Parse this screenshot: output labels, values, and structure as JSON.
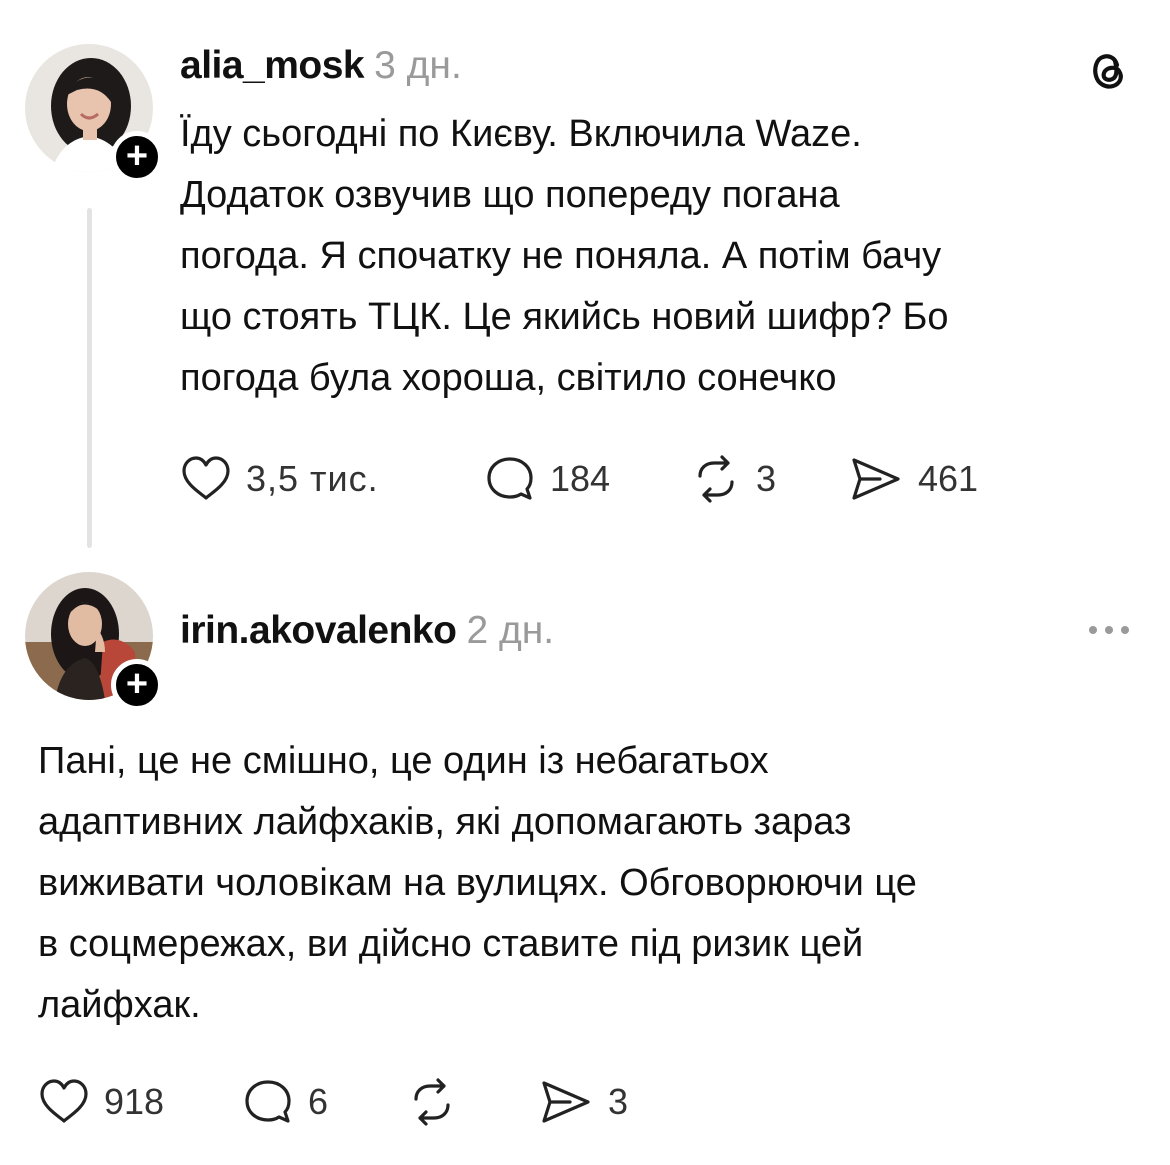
{
  "post": {
    "username": "alia_mosk",
    "time": "3 дн.",
    "lines": [
      "Їду сьогодні по Києву. Включила Waze.",
      "Додаток озвучив що попереду погана",
      "погода. Я спочатку не поняла. А потім бачу",
      "що стоять ТЦК. Це якийсь новий шифр? Бо",
      "погода була хороша, світило сонечко"
    ],
    "likes": "3,5 тис.",
    "comments": "184",
    "reposts": "3",
    "shares": "461"
  },
  "reply": {
    "username": "irin.akovalenko",
    "time": "2 дн.",
    "lines": [
      "Пані, це не смішно, це один із небагатьох",
      "адаптивних лайфхаків, які допомагають зараз",
      "виживати чоловікам на вулицях. Обговорюючи це",
      "в соцмережах, ви дійсно ставите під ризик цей",
      "лайфхак."
    ],
    "likes": "918",
    "comments": "6",
    "reposts": "",
    "shares": "3"
  },
  "follow_badge": "+",
  "icons": {
    "brand": "threads-logo-icon",
    "more": "more-options-icon",
    "like": "heart-icon",
    "comment": "comment-icon",
    "repost": "repost-icon",
    "share": "share-icon"
  },
  "colors": {
    "text": "#111111",
    "muted": "#9a9a9a",
    "thread_line": "#e3e3e3",
    "badge": "#000000"
  }
}
